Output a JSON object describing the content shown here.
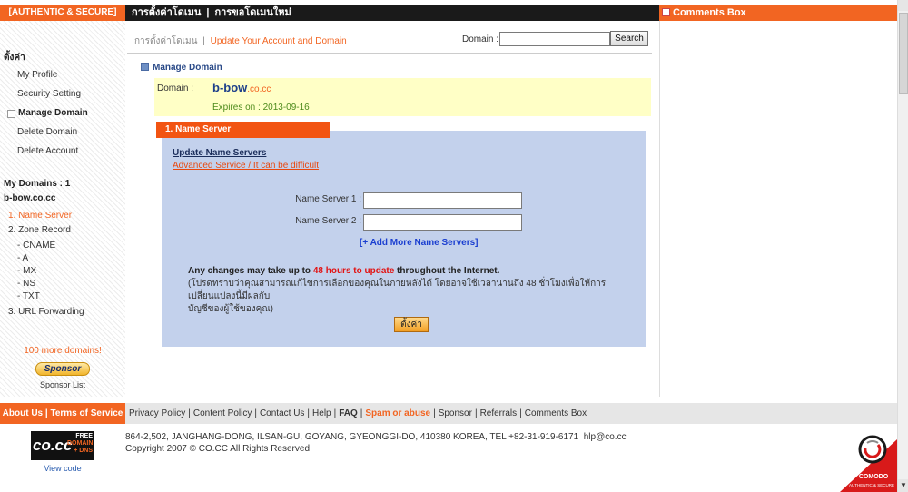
{
  "topbar": {
    "auth_label": "[AUTHENTIC & SECURE]",
    "nav": [
      "การตั้งค่าโดเมน",
      "การขอโดเมนใหม่"
    ],
    "nav_sep": "|",
    "comments_title": "Comments Box"
  },
  "sidebar": {
    "settings_title": "ตั้งค่า",
    "items": [
      "My Profile",
      "Security Setting",
      "Manage Domain",
      "Delete Domain",
      "Delete Account"
    ],
    "my_domains_title": "My Domains : 1",
    "domain": "b-bow.co.cc",
    "records": [
      "1. Name Server",
      "2. Zone Record",
      "- CNAME",
      "- A",
      "- MX",
      "- NS",
      "- TXT",
      "3. URL Forwarding"
    ],
    "more_domains": "100 more domains!",
    "sponsor_button": "Sponsor",
    "sponsor_list": "Sponsor List"
  },
  "main": {
    "breadcrumb_root": "การตั้งค่าโดเมน",
    "breadcrumb_sep": "|",
    "breadcrumb_current": "Update Your Account and Domain",
    "search_label": "Domain :",
    "search_value": "",
    "search_button": "Search",
    "manage_heading": "Manage Domain",
    "domain_label": "Domain :",
    "domain_name_main": "b-bow",
    "domain_name_tld": ".co.cc",
    "expires": "Expires on : 2013-09-16",
    "ns_tab": "1. Name Server",
    "ns_title": "Update Name Servers",
    "ns_advanced": "Advanced Service / It can be difficult",
    "ns1_label": "Name Server 1 :",
    "ns2_label": "Name Server 2 :",
    "ns1_value": "",
    "ns2_value": "",
    "add_more": "[+ Add More Name Servers]",
    "notice_prefix": "Any changes may take up to ",
    "notice_highlight": "48 hours to update",
    "notice_suffix": " throughout the Internet.",
    "notice_thai_1": "(โปรดทราบว่าคุณสามารถแก้ไขการเลือกของคุณในภายหลังได้ โดยอาจใช้เวลานานถึง 48 ชั่วโมงเพื่อให้การเปลี่ยนแปลงนี้มีผลกับ",
    "notice_thai_2": "บัญชีของผู้ใช้ของคุณ)",
    "submit_button": "ตั้งค่า"
  },
  "footer": {
    "left": "About Us | Terms of Service",
    "links": [
      "Privacy Policy",
      "Content Policy",
      "Contact Us",
      "Help",
      "FAQ",
      "Spam or abuse",
      "Sponsor",
      "Referrals",
      "Comments Box"
    ],
    "address": "864-2,502, JANGHANG-DONG, ILSAN-GU, GOYANG, GYEONGGI-DO, 410380 KOREA, TEL +82-31-919-6171",
    "email": "hlp@co.cc",
    "copyright": "Copyright 2007 © CO.CC All Rights Reserved",
    "logo_text": "co.cc",
    "logo_free_1": "FREE",
    "logo_free_2": "DOMAIN",
    "logo_free_3": "+ DNS",
    "view_code": "View code",
    "comodo_text": "COMODO",
    "comodo_sub": "AUTHENTIC & SECURE"
  },
  "colors": {
    "accent": "#f26522",
    "panel": "#c3d1ec",
    "domain_box": "#ffffc6",
    "link": "#1a3ed0"
  }
}
